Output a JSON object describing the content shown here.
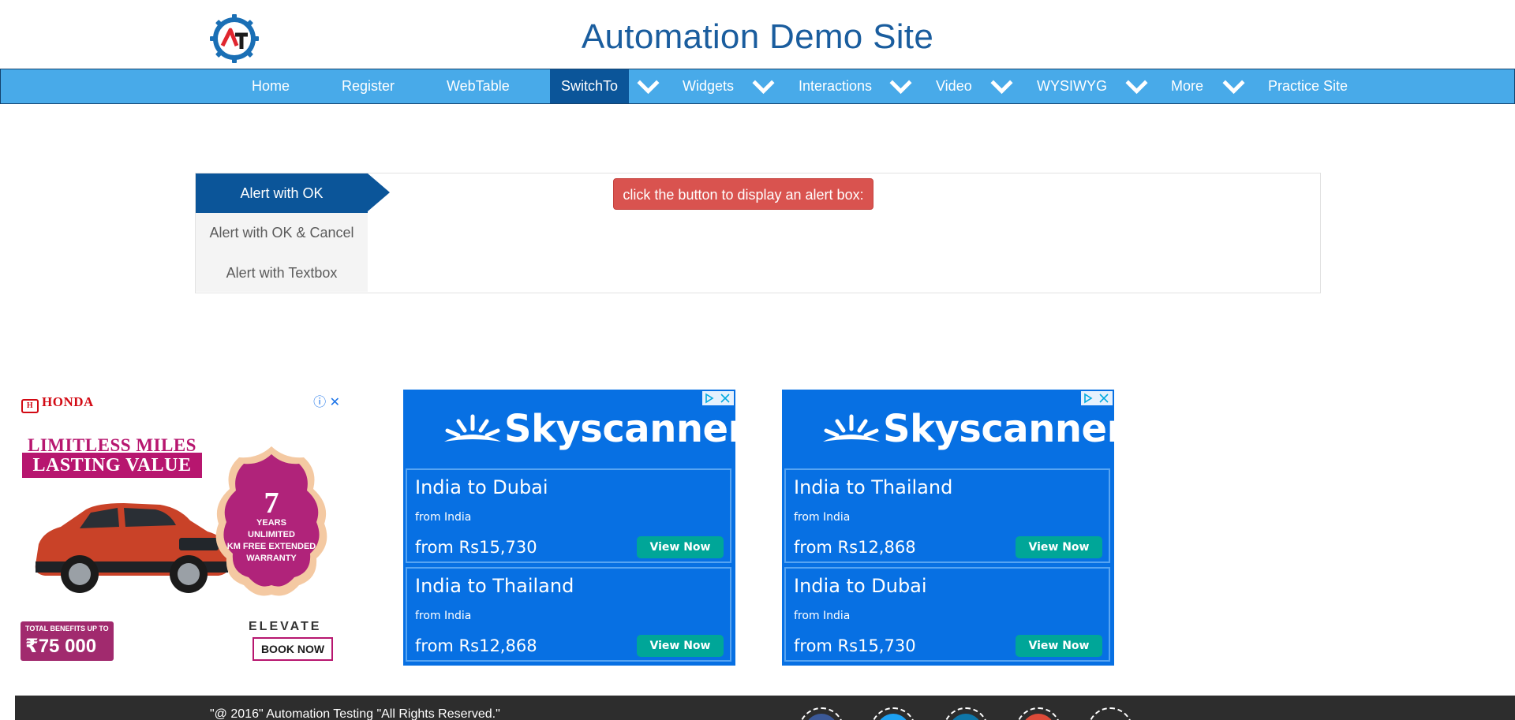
{
  "header": {
    "logo_letters": "AT",
    "title": "Automation Demo Site"
  },
  "nav": {
    "items": [
      {
        "label": "Home"
      },
      {
        "label": "Register"
      },
      {
        "label": "WebTable"
      },
      {
        "label": "SwitchTo",
        "active": true
      },
      {
        "label": "Widgets"
      },
      {
        "label": "Interactions"
      },
      {
        "label": "Video"
      },
      {
        "label": "WYSIWYG"
      },
      {
        "label": "More"
      },
      {
        "label": "Practice Site"
      }
    ]
  },
  "alerts": {
    "tabs": [
      {
        "label": "Alert with OK",
        "active": true
      },
      {
        "label": "Alert with OK & Cancel"
      },
      {
        "label": "Alert with Textbox"
      }
    ],
    "button_label": "click the button to display an alert box:"
  },
  "ads": {
    "honda": {
      "brand": "HONDA",
      "headline_1": "LIMITLESS MILES",
      "headline_2": "LASTING VALUE",
      "warranty_years": "7",
      "warranty_line_1": "YEARS",
      "warranty_line_2": "UNLIMITED",
      "warranty_line_3": "KM FREE EXTENDED",
      "warranty_line_4": "WARRANTY",
      "benefits_label": "TOTAL BENEFITS UP TO",
      "benefits_value": "₹75 000",
      "model": "ELEVATE",
      "cta": "BOOK NOW"
    },
    "skyscanner": [
      {
        "brand": "Skyscanner",
        "deals": [
          {
            "route": "India to Dubai",
            "from": "from India",
            "price": "from Rs15,730",
            "cta": "View Now"
          },
          {
            "route": "India to Thailand",
            "from": "from India",
            "price": "from Rs12,868",
            "cta": "View Now"
          }
        ]
      },
      {
        "brand": "Skyscanner",
        "deals": [
          {
            "route": "India to Thailand",
            "from": "from India",
            "price": "from Rs12,868",
            "cta": "View Now"
          },
          {
            "route": "India to Dubai",
            "from": "from India",
            "price": "from Rs15,730",
            "cta": "View Now"
          }
        ]
      }
    ]
  },
  "footer": {
    "copyright": "\"@ 2016\" Automation Testing \"All Rights Reserved.\"",
    "social_colors": [
      "#3b5998",
      "#1da1f2",
      "#0e76a8",
      "#dd4b39",
      "#2d2d2d"
    ]
  },
  "colors": {
    "nav_bg": "#48aae9",
    "nav_active": "#0b5599",
    "title": "#1a5d9e",
    "alert_button": "#d9534f",
    "skyscanner_blue": "#0770e3",
    "skyscanner_cta": "#00a698"
  }
}
